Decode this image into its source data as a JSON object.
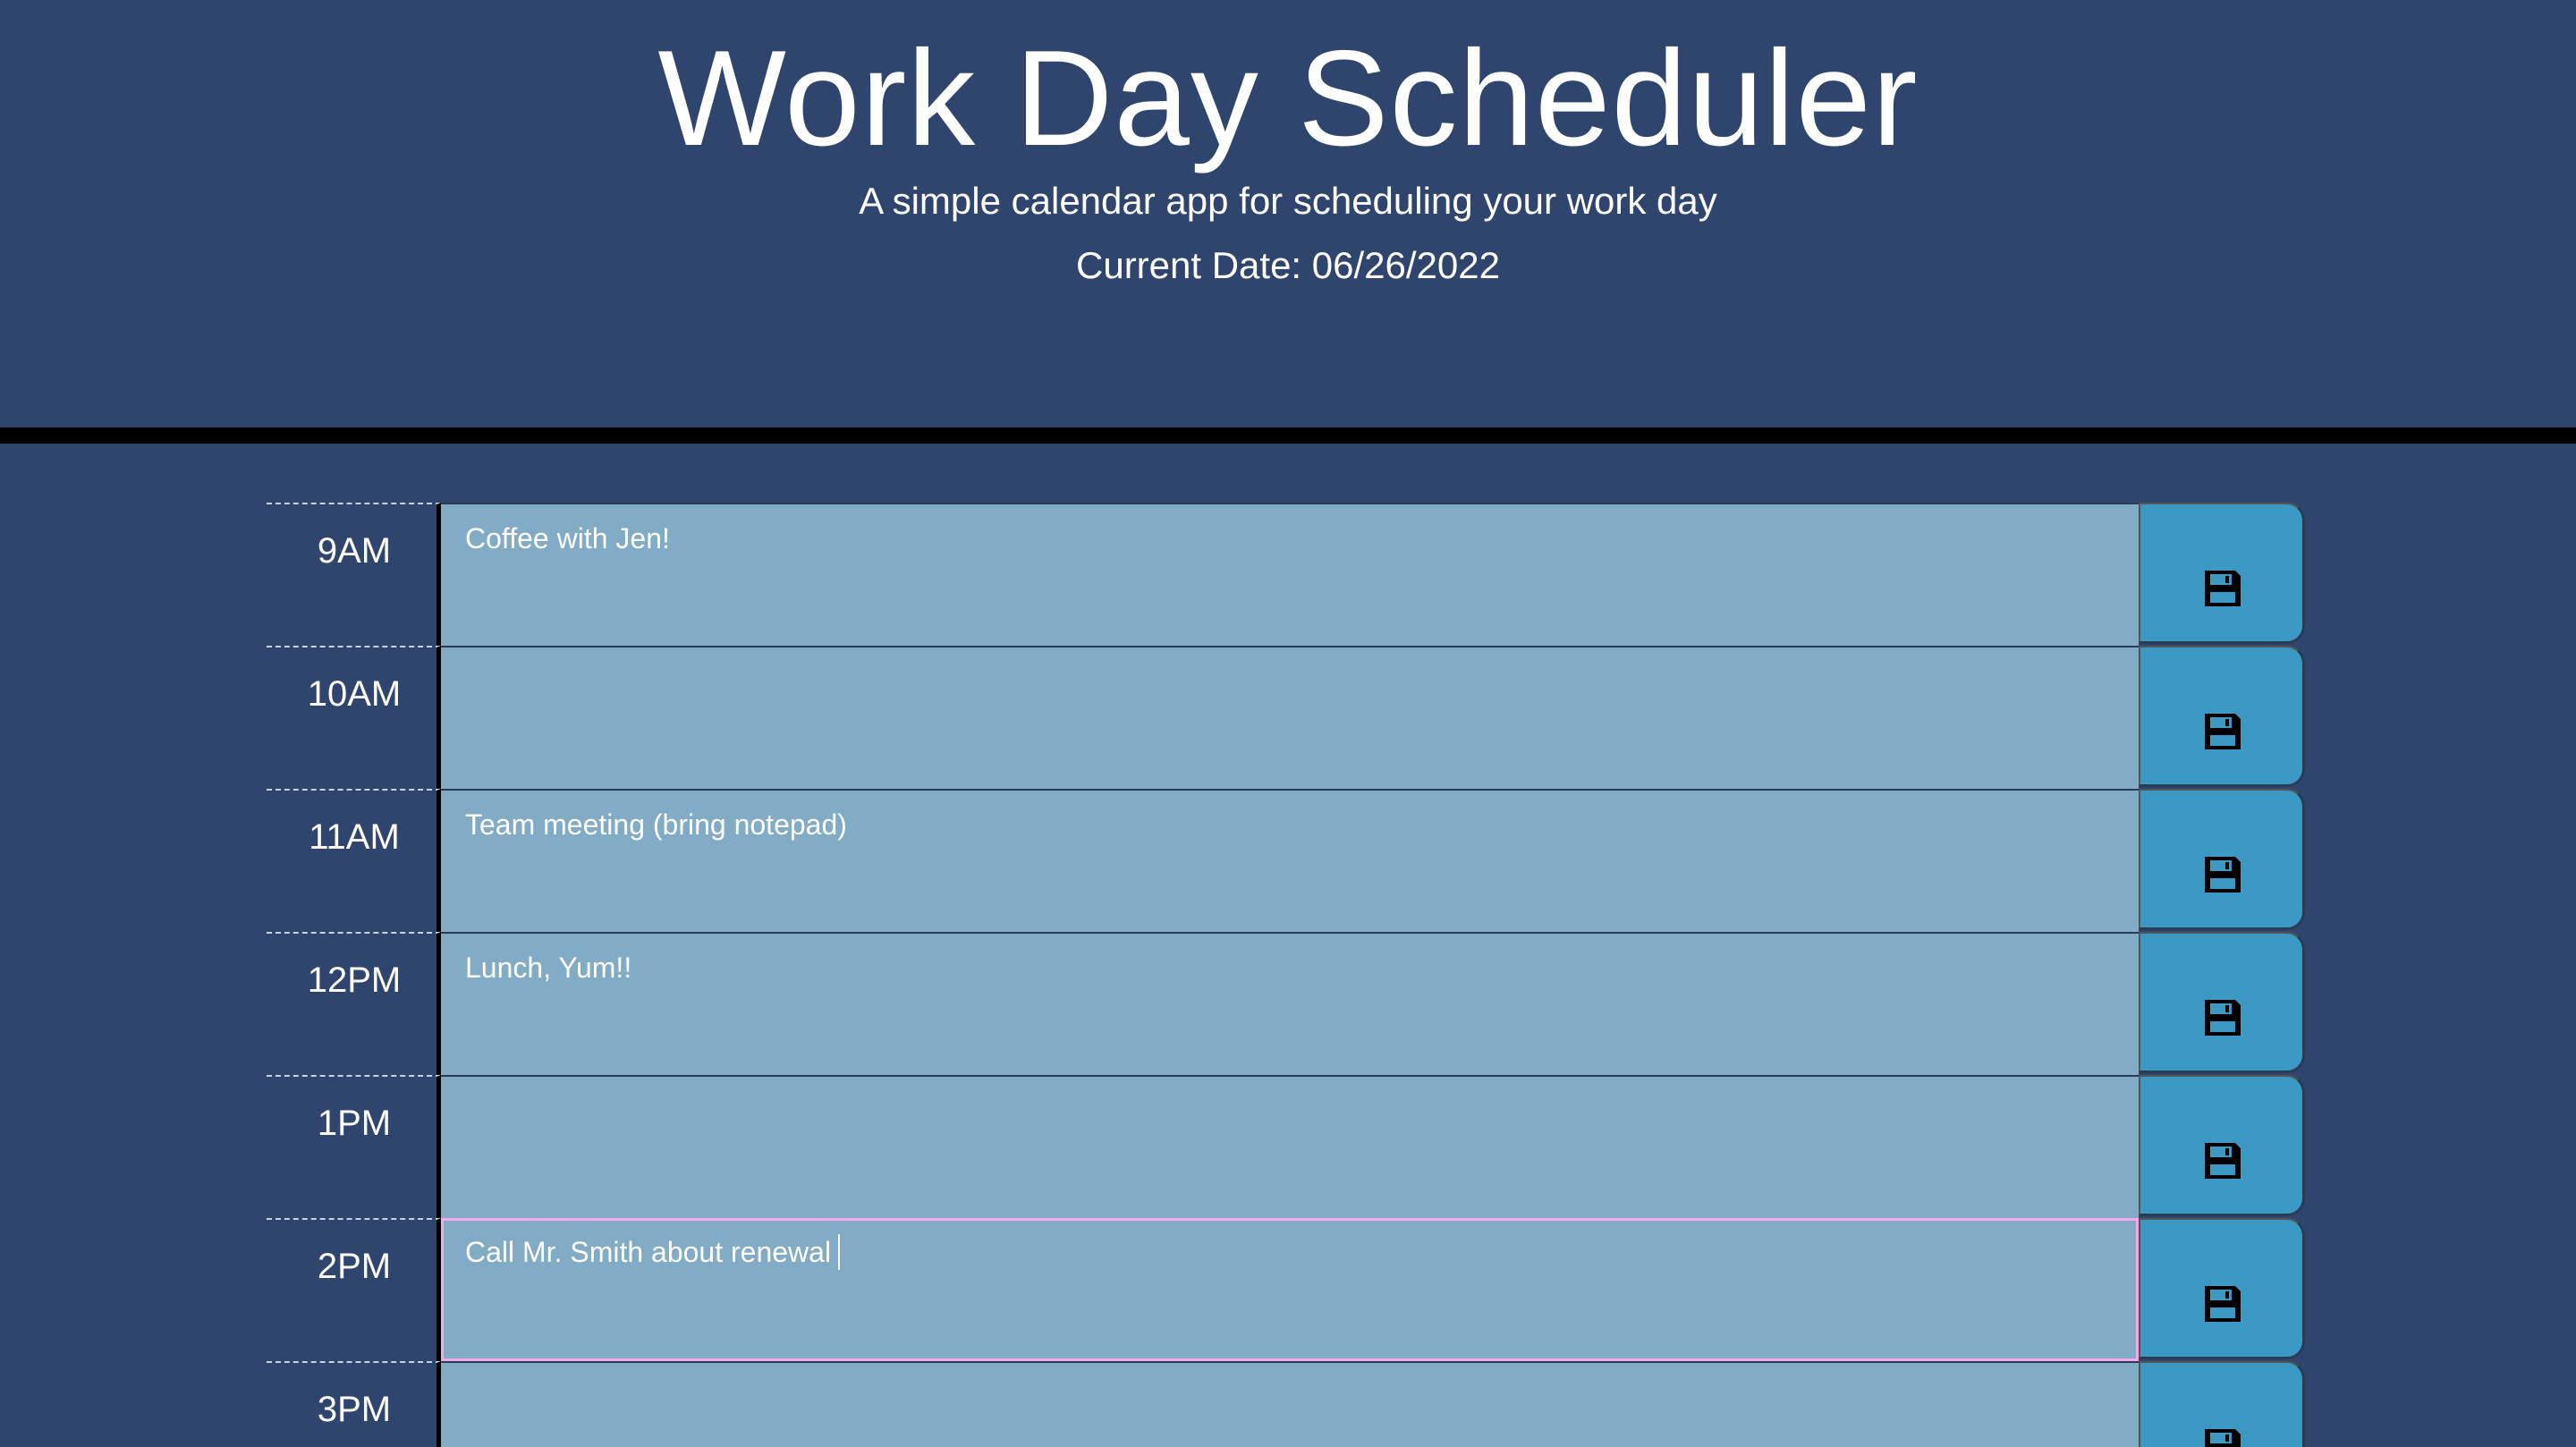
{
  "header": {
    "title": "Work Day Scheduler",
    "subtitle": "A simple calendar app for scheduling your work day",
    "current_date": "Current Date: 06/26/2022"
  },
  "colors": {
    "background": "#30456d",
    "divider": "#000000",
    "row_fill": "#82abc5",
    "save_button": "#3b99c3",
    "active_outline": "#f3a9ec"
  },
  "rows": [
    {
      "hour": "9AM",
      "text": "Coffee with Jen!",
      "save_icon": "floppy-disk-icon"
    },
    {
      "hour": "10AM",
      "text": "",
      "save_icon": "floppy-disk-icon"
    },
    {
      "hour": "11AM",
      "text": "Team meeting (bring notepad)",
      "save_icon": "floppy-disk-icon"
    },
    {
      "hour": "12PM",
      "text": "Lunch, Yum!!",
      "save_icon": "floppy-disk-icon"
    },
    {
      "hour": "1PM",
      "text": "",
      "save_icon": "floppy-disk-icon"
    },
    {
      "hour": "2PM",
      "text": "Call Mr. Smith about renewal",
      "save_icon": "floppy-disk-icon"
    },
    {
      "hour": "3PM",
      "text": "",
      "save_icon": "floppy-disk-icon"
    }
  ]
}
